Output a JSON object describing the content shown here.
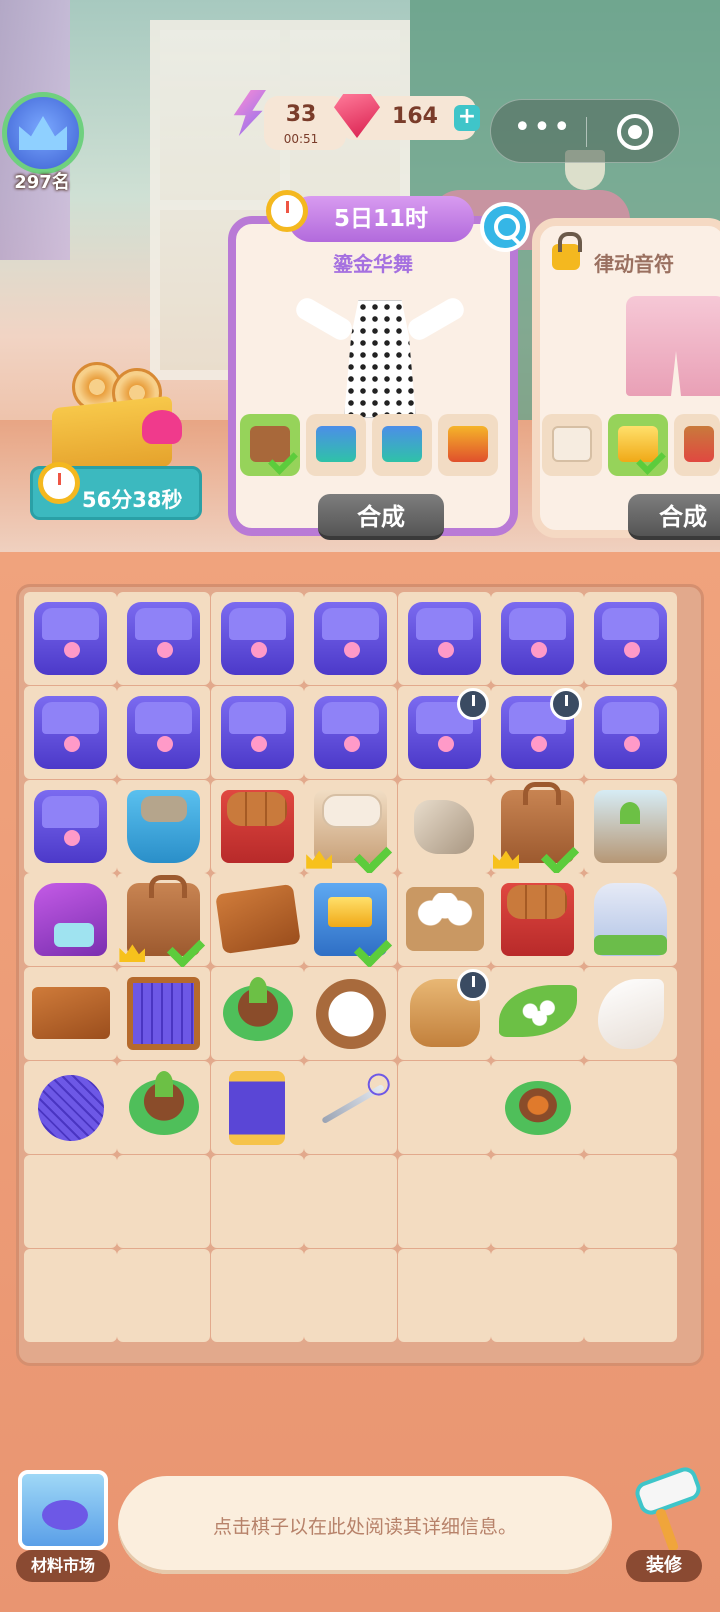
{
  "hud": {
    "rank_label": "297名",
    "energy": {
      "value": "33",
      "timer": "00:51"
    },
    "gems": {
      "value": "164",
      "add_label": "+"
    },
    "capsule": {
      "more_label": "•••"
    }
  },
  "gift": {
    "timer": "56分38秒"
  },
  "orders": [
    {
      "time_left": "5日11时",
      "title": "鎏金华舞",
      "locked": false,
      "requirements": [
        {
          "icon": "leather-bag-icon",
          "done": true
        },
        {
          "icon": "fabric-stack-icon",
          "done": false
        },
        {
          "icon": "fabric-stack-icon",
          "done": false
        },
        {
          "icon": "sewing-machine-icon",
          "done": false
        }
      ],
      "button": "合成"
    },
    {
      "title": "律动音符",
      "locked": true,
      "requirements": [
        {
          "icon": "cloth-roll-icon",
          "done": false
        },
        {
          "icon": "gold-bars-icon",
          "done": true
        },
        {
          "icon": "wood-rolls-icon",
          "done": false
        }
      ],
      "button": "合成"
    }
  ],
  "board": {
    "columns": 7,
    "rows": 8,
    "cells": [
      [
        "sewing-kit",
        "sewing-kit",
        "sewing-kit",
        "sewing-kit",
        "sewing-kit",
        "sewing-kit",
        "sewing-kit"
      ],
      [
        "sewing-kit",
        "sewing-kit",
        "sewing-kit",
        "sewing-kit",
        "sewing-kit",
        "sewing-kit",
        "sewing-kit"
      ],
      [
        "sewing-kit",
        "stone-bucket",
        "wood-rolls",
        "towel-basket",
        "stone",
        "leather-bag",
        "sprout-box"
      ],
      [
        "sewing-machine",
        "leather-bag",
        "leather-sheet",
        "gold-bars",
        "cotton-tray",
        "wood-rolls",
        "silk-cushion"
      ],
      [
        "leather-strips",
        "yarn-loom",
        "sprout-pot",
        "cotton-plate",
        "seed-sack",
        "leaf-pearls",
        "feather"
      ],
      [
        "yarn-ball",
        "sprout-pot",
        "thread-spool",
        "needle-thread",
        "",
        "seed-pot",
        ""
      ],
      [
        "",
        "",
        "",
        "",
        "",
        "",
        ""
      ],
      [
        "",
        "",
        "",
        "",
        "",
        "",
        ""
      ]
    ],
    "checked": [
      [
        2,
        3
      ],
      [
        2,
        5
      ],
      [
        3,
        1
      ],
      [
        3,
        3
      ]
    ],
    "crowned": [
      [
        2,
        3
      ],
      [
        2,
        5
      ],
      [
        3,
        1
      ]
    ],
    "timers": [
      [
        1,
        4
      ],
      [
        1,
        5
      ],
      [
        4,
        4
      ]
    ]
  },
  "bottom": {
    "market_label": "材料市场",
    "info_text": "点击棋子以在此处阅读其详细信息。",
    "decor_label": "装修"
  }
}
